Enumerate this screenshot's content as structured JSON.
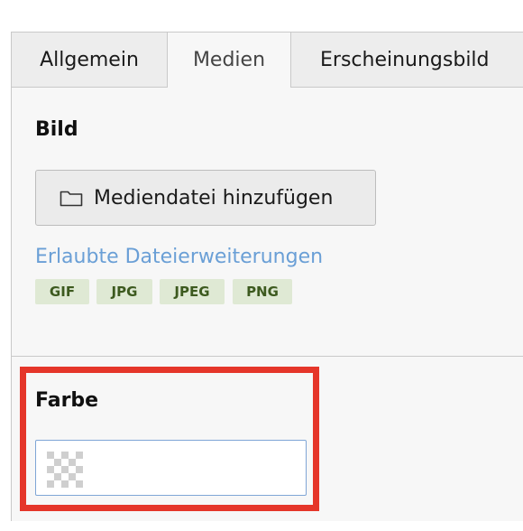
{
  "tabs": [
    {
      "label": "Allgemein"
    },
    {
      "label": "Medien"
    },
    {
      "label": "Erscheinungsbild"
    }
  ],
  "active_tab": "Medien",
  "bild": {
    "label": "Bild",
    "add_button_label": "Mediendatei hinzufügen",
    "add_button_icon": "folder-icon",
    "allowed_extensions_label": "Erlaubte Dateierweiterungen",
    "extensions": [
      "GIF",
      "JPG",
      "JPEG",
      "PNG"
    ]
  },
  "farbe": {
    "label": "Farbe",
    "value": ""
  },
  "colors": {
    "highlight": "#e5362a",
    "link": "#6a9fd6",
    "badge_bg": "#dfe9d4",
    "badge_text": "#3d5a1f"
  }
}
